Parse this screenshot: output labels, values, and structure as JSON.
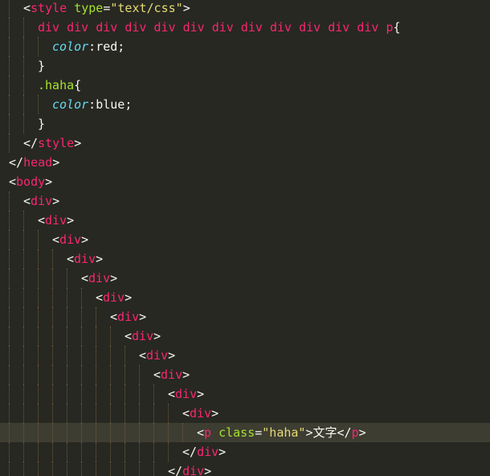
{
  "colors": {
    "background": "#272822",
    "active_line": "#3e3d32",
    "tag": "#f92672",
    "attr": "#a6e22e",
    "string": "#e6db74",
    "property": "#66d9ef",
    "plain": "#f8f8f2",
    "guide": "#6b5a3c"
  },
  "editor": {
    "active_line_index": 22,
    "lines": [
      {
        "indent": 1,
        "tokens": [
          [
            "<",
            "plain"
          ],
          [
            "style",
            "tag"
          ],
          [
            " ",
            "plain"
          ],
          [
            "type",
            "attr"
          ],
          [
            "=",
            "plain"
          ],
          [
            "\"text/css\"",
            "string"
          ],
          [
            ">",
            "plain"
          ]
        ]
      },
      {
        "indent": 2,
        "tokens": [
          [
            "div div div div div div div div div div div div p",
            "tag"
          ],
          [
            "{",
            "plain"
          ]
        ]
      },
      {
        "indent": 3,
        "tokens": [
          [
            "color",
            "property"
          ],
          [
            ":",
            "plain"
          ],
          [
            "red",
            "plain"
          ],
          [
            ";",
            "plain"
          ]
        ]
      },
      {
        "indent": 2,
        "tokens": [
          [
            "}",
            "plain"
          ]
        ]
      },
      {
        "indent": 2,
        "tokens": [
          [
            ".haha",
            "attr"
          ],
          [
            "{",
            "plain"
          ]
        ]
      },
      {
        "indent": 3,
        "tokens": [
          [
            "color",
            "property"
          ],
          [
            ":",
            "plain"
          ],
          [
            "blue",
            "plain"
          ],
          [
            ";",
            "plain"
          ]
        ]
      },
      {
        "indent": 2,
        "tokens": [
          [
            "}",
            "plain"
          ]
        ]
      },
      {
        "indent": 1,
        "tokens": [
          [
            "</",
            "plain"
          ],
          [
            "style",
            "tag"
          ],
          [
            ">",
            "plain"
          ]
        ]
      },
      {
        "indent": 0,
        "tokens": [
          [
            "</",
            "plain"
          ],
          [
            "head",
            "tag"
          ],
          [
            ">",
            "plain"
          ]
        ]
      },
      {
        "indent": 0,
        "tokens": [
          [
            "<",
            "plain"
          ],
          [
            "body",
            "tag"
          ],
          [
            ">",
            "plain"
          ]
        ]
      },
      {
        "indent": 1,
        "tokens": [
          [
            "<",
            "plain"
          ],
          [
            "div",
            "tag"
          ],
          [
            ">",
            "plain"
          ]
        ]
      },
      {
        "indent": 2,
        "tokens": [
          [
            "<",
            "plain"
          ],
          [
            "div",
            "tag"
          ],
          [
            ">",
            "plain"
          ]
        ]
      },
      {
        "indent": 3,
        "tokens": [
          [
            "<",
            "plain"
          ],
          [
            "div",
            "tag"
          ],
          [
            ">",
            "plain"
          ]
        ]
      },
      {
        "indent": 4,
        "tokens": [
          [
            "<",
            "plain"
          ],
          [
            "div",
            "tag"
          ],
          [
            ">",
            "plain"
          ]
        ]
      },
      {
        "indent": 5,
        "tokens": [
          [
            "<",
            "plain"
          ],
          [
            "div",
            "tag"
          ],
          [
            ">",
            "plain"
          ]
        ]
      },
      {
        "indent": 6,
        "tokens": [
          [
            "<",
            "plain"
          ],
          [
            "div",
            "tag"
          ],
          [
            ">",
            "plain"
          ]
        ]
      },
      {
        "indent": 7,
        "tokens": [
          [
            "<",
            "plain"
          ],
          [
            "div",
            "tag"
          ],
          [
            ">",
            "plain"
          ]
        ]
      },
      {
        "indent": 8,
        "tokens": [
          [
            "<",
            "plain"
          ],
          [
            "div",
            "tag"
          ],
          [
            ">",
            "plain"
          ]
        ]
      },
      {
        "indent": 9,
        "tokens": [
          [
            "<",
            "plain"
          ],
          [
            "div",
            "tag"
          ],
          [
            ">",
            "plain"
          ]
        ]
      },
      {
        "indent": 10,
        "tokens": [
          [
            "<",
            "plain"
          ],
          [
            "div",
            "tag"
          ],
          [
            ">",
            "plain"
          ]
        ]
      },
      {
        "indent": 11,
        "tokens": [
          [
            "<",
            "plain"
          ],
          [
            "div",
            "tag"
          ],
          [
            ">",
            "plain"
          ]
        ]
      },
      {
        "indent": 12,
        "tokens": [
          [
            "<",
            "plain"
          ],
          [
            "div",
            "tag"
          ],
          [
            ">",
            "plain"
          ]
        ]
      },
      {
        "indent": 13,
        "tokens": [
          [
            "<",
            "plain"
          ],
          [
            "p",
            "tag"
          ],
          [
            " ",
            "plain"
          ],
          [
            "class",
            "attr"
          ],
          [
            "=",
            "plain"
          ],
          [
            "\"haha\"",
            "string"
          ],
          [
            ">",
            "plain"
          ],
          [
            "文字",
            "plain"
          ],
          [
            "</",
            "plain"
          ],
          [
            "p",
            "tag"
          ],
          [
            ">",
            "plain"
          ]
        ]
      },
      {
        "indent": 12,
        "tokens": [
          [
            "</",
            "plain"
          ],
          [
            "div",
            "tag"
          ],
          [
            ">",
            "plain"
          ]
        ]
      },
      {
        "indent": 11,
        "tokens": [
          [
            "</",
            "plain"
          ],
          [
            "div",
            "tag"
          ],
          [
            ">",
            "plain"
          ]
        ]
      }
    ]
  }
}
